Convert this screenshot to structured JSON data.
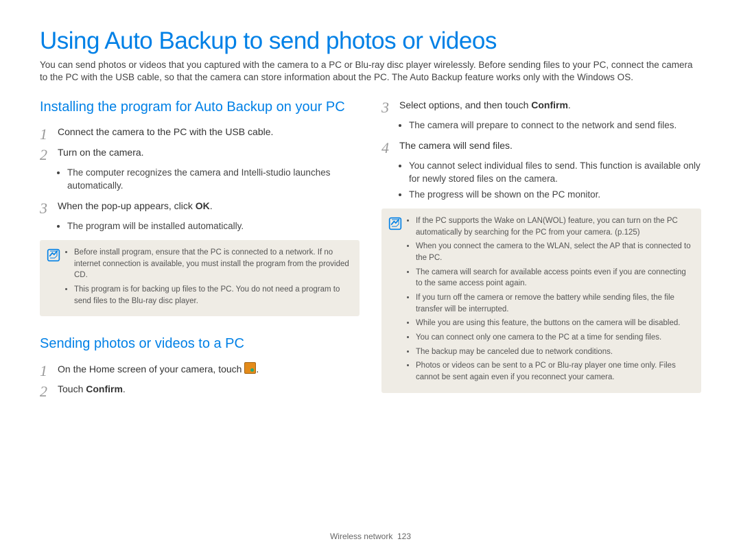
{
  "title": "Using Auto Backup to send photos or videos",
  "intro": "You can send photos or videos that you captured with the camera to a PC or Blu-ray disc player wirelessly. Before sending files to your PC, connect the camera to the PC with the USB cable, so that the camera can store information about the PC. The Auto Backup feature works only with the Windows OS.",
  "left": {
    "section1": {
      "title": "Installing the program for Auto Backup on your PC",
      "step1": "Connect the camera to the PC with the USB cable.",
      "step2": "Turn on the camera.",
      "step2_bullets": [
        "The computer recognizes the camera and Intelli-studio launches automatically."
      ],
      "step3_pre": "When the pop-up appears, click ",
      "step3_ok": "OK",
      "step3_post": ".",
      "step3_bullets": [
        "The program will be installed automatically."
      ],
      "note": [
        "Before install program, ensure that the PC is connected to a network. If no internet connection is available, you must install the program from the provided CD.",
        "This program is for backing up files to the PC. You do not need a program to send files to the Blu-ray disc player."
      ]
    },
    "section2": {
      "title": "Sending photos or videos to a PC",
      "step1_pre": "On the Home screen of your camera, touch ",
      "step1_post": ".",
      "step2_pre": "Touch ",
      "step2_bold": "Confirm",
      "step2_post": "."
    }
  },
  "right": {
    "step3_pre": "Select options, and then touch ",
    "step3_bold": "Confirm",
    "step3_post": ".",
    "step3_bullets": [
      "The camera will prepare to connect to the network and send files."
    ],
    "step4": "The camera will send files.",
    "step4_bullets": [
      "You cannot select individual files to send. This function is available only for newly stored files on the camera.",
      "The progress will be shown on the PC monitor."
    ],
    "note": [
      "If the PC supports the Wake on LAN(WOL) feature, you can turn on the PC automatically by searching for the PC from your camera. (p.125)",
      "When you connect the camera to the WLAN, select the AP that is connected to the PC.",
      "The camera will search for available access points even if you are connecting to the same access point again.",
      "If you turn off the camera or remove the battery while sending files, the file transfer will be interrupted.",
      "While you are using this feature, the buttons on the camera will be disabled.",
      "You can connect only one camera to the PC at a time for sending files.",
      "The backup may be canceled due to network conditions.",
      "Photos or videos can be sent to a PC or Blu-ray player one time only. Files cannot be sent again even if you reconnect your camera."
    ]
  },
  "footer": {
    "section": "Wireless network",
    "page": "123"
  },
  "nums": {
    "n1": "1",
    "n2": "2",
    "n3": "3",
    "n4": "4"
  }
}
